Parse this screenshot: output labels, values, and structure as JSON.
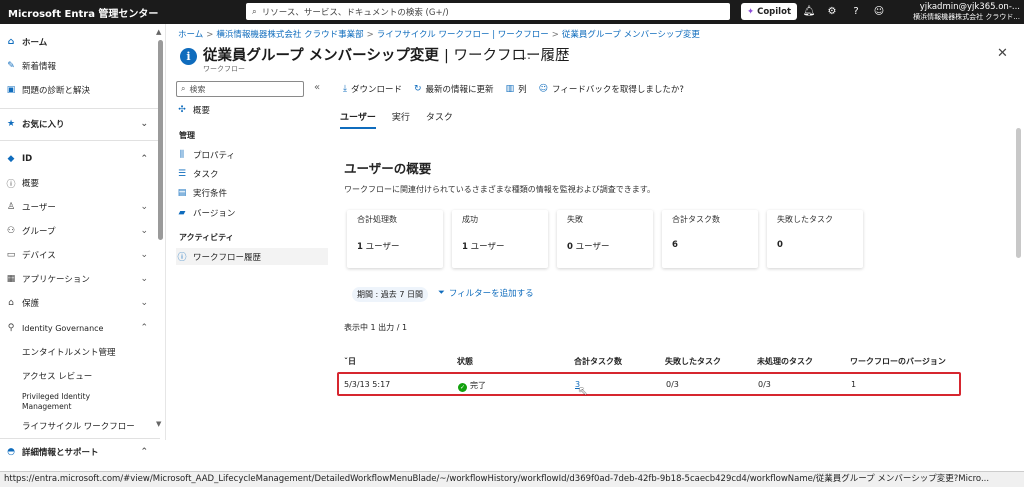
{
  "topbar": {
    "brand": "Microsoft Entra 管理センター",
    "search_placeholder": "リソース、サービス、ドキュメントの検索 (G+/)",
    "copilot": "Copilot",
    "account_email": "yjkadmin@yjk365.on-...",
    "account_org": "横浜情報機器株式会社 クラウド..."
  },
  "sidebar": {
    "home": "ホーム",
    "whats_new": "新着情報",
    "diagnose": "問題の診断と解決",
    "favorites": "お気に入り",
    "id": "ID",
    "overview": "概要",
    "users": "ユーザー",
    "groups": "グループ",
    "devices": "デバイス",
    "applications": "アプリケーション",
    "protection": "保護",
    "identity_governance": "Identity Governance",
    "entitlement": "エンタイトルメント管理",
    "access_review": "アクセス レビュー",
    "pim": "Privileged Identity Management",
    "lifecycle": "ライフサイクル ワークフロー",
    "learn_support": "詳細情報とサポート"
  },
  "breadcrumb": [
    "ホーム",
    "横浜情報機器株式会社 クラウド事業部",
    "ライフサイクル ワークフロー | ワークフロー",
    "従業員グループ メンバーシップ変更"
  ],
  "page": {
    "title": "従業員グループ メンバーシップ変更",
    "title_suffix": "| ワークフロー履歴",
    "subtitle": "ワークフロー"
  },
  "leftnav": {
    "search_placeholder": "検索",
    "overview": "概要",
    "manage_header": "管理",
    "properties": "プロパティ",
    "tasks": "タスク",
    "conditions": "実行条件",
    "versions": "バージョン",
    "activity_header": "アクティビティ",
    "history": "ワークフロー履歴"
  },
  "toolbar": {
    "download": "ダウンロード",
    "refresh": "最新の情報に更新",
    "columns": "列",
    "feedback": "フィードバックを取得しましたか?"
  },
  "tabs": [
    "ユーザー",
    "実行",
    "タスク"
  ],
  "summary": {
    "title": "ユーザーの概要",
    "description": "ワークフローに関連付けられているさまざまな種類の情報を監視および調査できます。",
    "cards": [
      {
        "label": "合計処理数",
        "num": "1",
        "unit": " ユーザー"
      },
      {
        "label": "成功",
        "num": "1",
        "unit": " ユーザー"
      },
      {
        "label": "失敗",
        "num": "0",
        "unit": " ユーザー"
      },
      {
        "label": "合計タスク数",
        "num": "6",
        "unit": ""
      },
      {
        "label": "失敗したタスク",
        "num": "0",
        "unit": ""
      }
    ]
  },
  "filters": {
    "period": "期間 : 過去 7 日間",
    "add_filter": "フィルターを追加する"
  },
  "results": {
    "showing": "表示中 1 出力 / 1",
    "columns": [
      "ˇ日",
      "状態",
      "合計タスク数",
      "失敗したタスク",
      "未処理のタスク",
      "ワークフローのバージョン"
    ],
    "rows": [
      [
        "5/3/13 5:17",
        "完了",
        "3",
        "0/3",
        "0/3",
        "1"
      ]
    ]
  },
  "statusbar": {
    "url": "https://entra.microsoft.com/#view/Microsoft_AAD_LifecycleManagement/DetailedWorkflowMenuBlade/~/workflowHistory/workflowId/d369f0ad-7deb-42fb-9b18-5caecb429cd4/workflowName/従業員グループ メンバーシップ変更?Micro..."
  }
}
